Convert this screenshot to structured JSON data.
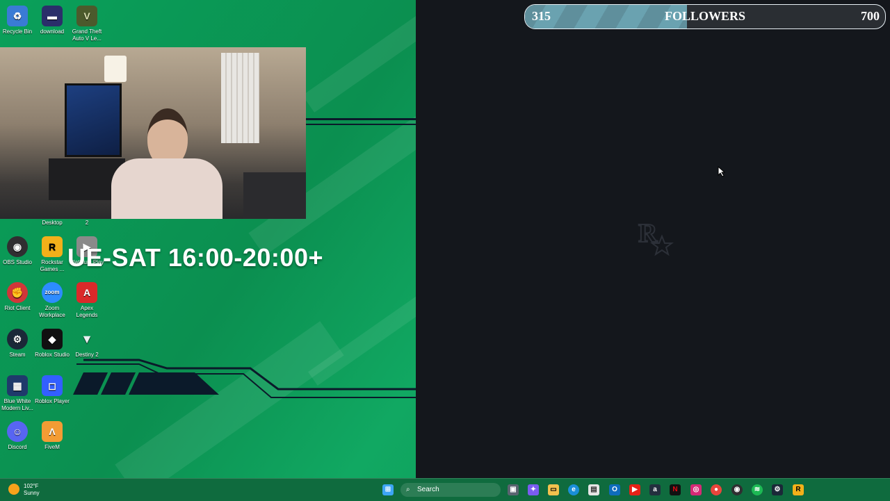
{
  "desktop_icons": [
    {
      "label": "Recycle Bin",
      "icon": "recycle-bin-icon",
      "glyph": "♻",
      "color": "#3a7bd5"
    },
    {
      "label": "download",
      "icon": "image-file-icon",
      "glyph": "▬",
      "color": "#2a2f6a"
    },
    {
      "label": "Grand Theft Auto V Le...",
      "icon": "gta-v-icon",
      "glyph": "V",
      "color": "#4b5a2c"
    },
    {
      "label": "Desktop",
      "icon": "folder-icon",
      "glyph": "",
      "color": "transparent"
    },
    {
      "label": "2",
      "icon": "file-icon",
      "glyph": "",
      "color": "transparent"
    },
    {
      "label": "OBS Studio",
      "icon": "obs-icon",
      "glyph": "◉",
      "color": "#302e31"
    },
    {
      "label": "Rockstar Games ...",
      "icon": "rockstar-icon",
      "glyph": "R",
      "color": "#f3b01a"
    },
    {
      "label": "Platinum Play",
      "icon": "platinum-play-icon",
      "glyph": "▶",
      "color": "#8a8a8a"
    },
    {
      "label": "Riot Client",
      "icon": "riot-icon",
      "glyph": "✊",
      "color": "#d13639"
    },
    {
      "label": "Zoom Workplace",
      "icon": "zoom-icon",
      "glyph": "zoom",
      "color": "#2d8cff"
    },
    {
      "label": "Apex Legends",
      "icon": "apex-icon",
      "glyph": "A",
      "color": "#da292a"
    },
    {
      "label": "Steam",
      "icon": "steam-icon",
      "glyph": "⚙",
      "color": "#1b2838"
    },
    {
      "label": "Roblox Studio",
      "icon": "roblox-studio-icon",
      "glyph": "◆",
      "color": "#111111"
    },
    {
      "label": "Destiny 2",
      "icon": "destiny-icon",
      "glyph": "▼",
      "color": "transparent"
    },
    {
      "label": "Blue White Modern Liv...",
      "icon": "video-file-icon",
      "glyph": "▦",
      "color": "#1f3a6b"
    },
    {
      "label": "Roblox Player",
      "icon": "roblox-player-icon",
      "glyph": "◻",
      "color": "#335fff"
    },
    {
      "label": "Discord",
      "icon": "discord-icon",
      "glyph": "☺",
      "color": "#5865f2"
    },
    {
      "label": "FiveM",
      "icon": "fivem-icon",
      "glyph": "Λ",
      "color": "#f39c34"
    }
  ],
  "schedule_text": "UE-SAT 16:00-20:00+",
  "followers": {
    "current": "315",
    "label": "FOLLOWERS",
    "goal": "700",
    "progress": 0.45
  },
  "game_window": {
    "logo": "rockstar-logo-icon"
  },
  "taskbar": {
    "weather_temp": "102°F",
    "weather_desc": "Sunny",
    "search_placeholder": "Search",
    "apps": [
      "start-icon",
      "search-icon",
      "task-view-icon",
      "copilot-icon",
      "file-explorer-icon",
      "edge-icon",
      "store-icon",
      "outlook-icon",
      "youtube-icon",
      "amazon-icon",
      "netflix-icon",
      "instagram-icon",
      "chrome-icon",
      "obs-icon",
      "spotify-icon",
      "steam-icon",
      "rockstar-icon"
    ]
  }
}
